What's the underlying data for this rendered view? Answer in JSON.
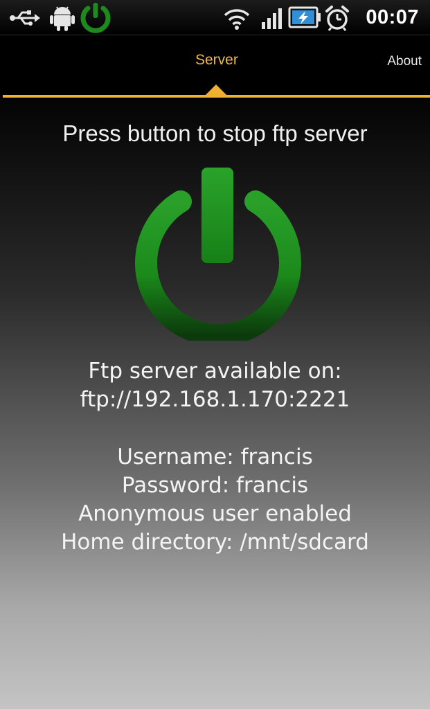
{
  "status_bar": {
    "time": "00:07",
    "icons": [
      "usb-icon",
      "android-debug-icon",
      "ftp-server-running-icon",
      "wifi-icon",
      "signal-icon",
      "battery-charging-icon",
      "alarm-icon"
    ]
  },
  "tabs": [
    {
      "label": "Server",
      "active": true
    },
    {
      "label": "About",
      "active": false
    }
  ],
  "server": {
    "instruction": "Press button to stop ftp server",
    "available_label": "Ftp server available on:",
    "url": "ftp://192.168.1.170:2221",
    "username": "Username: francis",
    "password": "Password: francis",
    "anonymous": "Anonymous user enabled",
    "home_directory": "Home directory: /mnt/sdcard"
  },
  "colors": {
    "accent": "#f0b030",
    "active_tab_text": "#f0b84a",
    "power_green": "#1f8f1f"
  }
}
